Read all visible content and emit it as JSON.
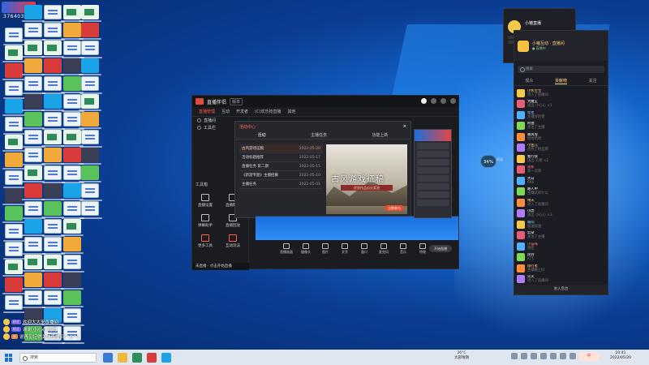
{
  "desktop": {
    "corner_badge_number": "3764031"
  },
  "app_window": {
    "app_name": "直播伴侣",
    "version_tag": "版本",
    "top_tabs": [
      "直播管理",
      "互动",
      "开发者",
      "(C)欢乐抢直播",
      "其他"
    ],
    "left_items": [
      "直播间",
      "工具栏"
    ],
    "section_label": "工具箱",
    "tools": [
      "直播设置",
      "直播数据",
      "弹幕助手",
      "直播回放",
      "更多工具",
      "互动玩法"
    ],
    "live_status": "未直播 · 点击开始直播",
    "popup": {
      "title": "活动中心",
      "close": "×",
      "tabs": [
        "活动",
        "主播任务",
        "功能上新"
      ],
      "items": [
        {
          "title": "古风游戏征稿",
          "date": "2022-05-20"
        },
        {
          "title": "活动标题推荐",
          "date": "2022-05-17"
        },
        {
          "title": "直播任务 第二期",
          "date": "2022-05-15"
        },
        {
          "title": "《新游专题》主播招募",
          "date": "2022-05-10"
        },
        {
          "title": "主播任务",
          "date": "2022-05-01"
        }
      ],
      "banner_title": "古风游戏征稿",
      "banner_sub": "优质作品瓜分奖池",
      "banner_btn": "立即参与"
    },
    "bottom_tools": [
      "直播画面",
      "摄像头",
      "图片",
      "文字",
      "窗口",
      "麦克风",
      "音乐",
      "特效"
    ],
    "start_button": "开始直播"
  },
  "chat_panel": {
    "room_title": "小猪互动 · 直播间",
    "status": "● 直播中",
    "search_placeholder": "搜索",
    "tabs": [
      "观众",
      "贡献榜",
      "关注"
    ],
    "messages": [
      {
        "user": "小熊宝宝",
        "text": "进入了直播间",
        "color": "#ffd47a"
      },
      {
        "user": "大魔王",
        "text": "送出 小心心 ×1",
        "color": "#ffffff"
      },
      {
        "user": "星星",
        "text": "主播好厉害",
        "color": "#7fd0ff"
      },
      {
        "user": "阿狸",
        "text": "关注了主播",
        "color": "#ffffff"
      },
      {
        "user": "暴风雪",
        "text": "哈哈哈哈",
        "color": "#ffffff"
      },
      {
        "user": "小鱼儿",
        "text": "点亮了粉丝牌",
        "color": "#ffd47a"
      },
      {
        "user": "独行侠",
        "text": "送出 礼物 ×2",
        "color": "#ffffff"
      },
      {
        "user": "萌新",
        "text": "第一次来",
        "color": "#ff7a7a"
      },
      {
        "user": "大白",
        "text": "666",
        "color": "#ffffff"
      },
      {
        "user": "路人甲",
        "text": "主播玩的什么",
        "color": "#ffffff"
      },
      {
        "user": "晴天",
        "text": "进入了直播间",
        "color": "#ffd47a"
      },
      {
        "user": "小虎",
        "text": "送出 小心心 ×3",
        "color": "#ffffff"
      },
      {
        "user": "暖阳",
        "text": "加油加油",
        "color": "#7fd0ff"
      },
      {
        "user": "云朵",
        "text": "关注了主播",
        "color": "#ffffff"
      },
      {
        "user": "小猫咪",
        "text": "哈哈",
        "color": "#ff7a7a"
      },
      {
        "user": "风铃",
        "text": "打卡",
        "color": "#ffffff"
      },
      {
        "user": "旅行者",
        "text": "主播晚上好",
        "color": "#ffd47a"
      },
      {
        "user": "火火",
        "text": "进入了直播间",
        "color": "#ffffff"
      }
    ],
    "footer": "进入后台"
  },
  "float_window": {
    "name": "小猪直播"
  },
  "speed_widget": {
    "value": "34%",
    "label": "网速"
  },
  "overlay_chat": [
    {
      "tag": "粉丝",
      "text": "欢迎大大来直播间"
    },
    {
      "tag": "粉丝",
      "text": "谢谢 小心心 礼物"
    },
    {
      "tag": "新",
      "text": "说再见记得关注直播间(^O^)"
    }
  ],
  "taskbar": {
    "search_placeholder": "搜索",
    "weather": "26°C",
    "weather_sub": "大部晴朗",
    "ime": "中",
    "time": "20:41",
    "date": "2022/05/20"
  }
}
